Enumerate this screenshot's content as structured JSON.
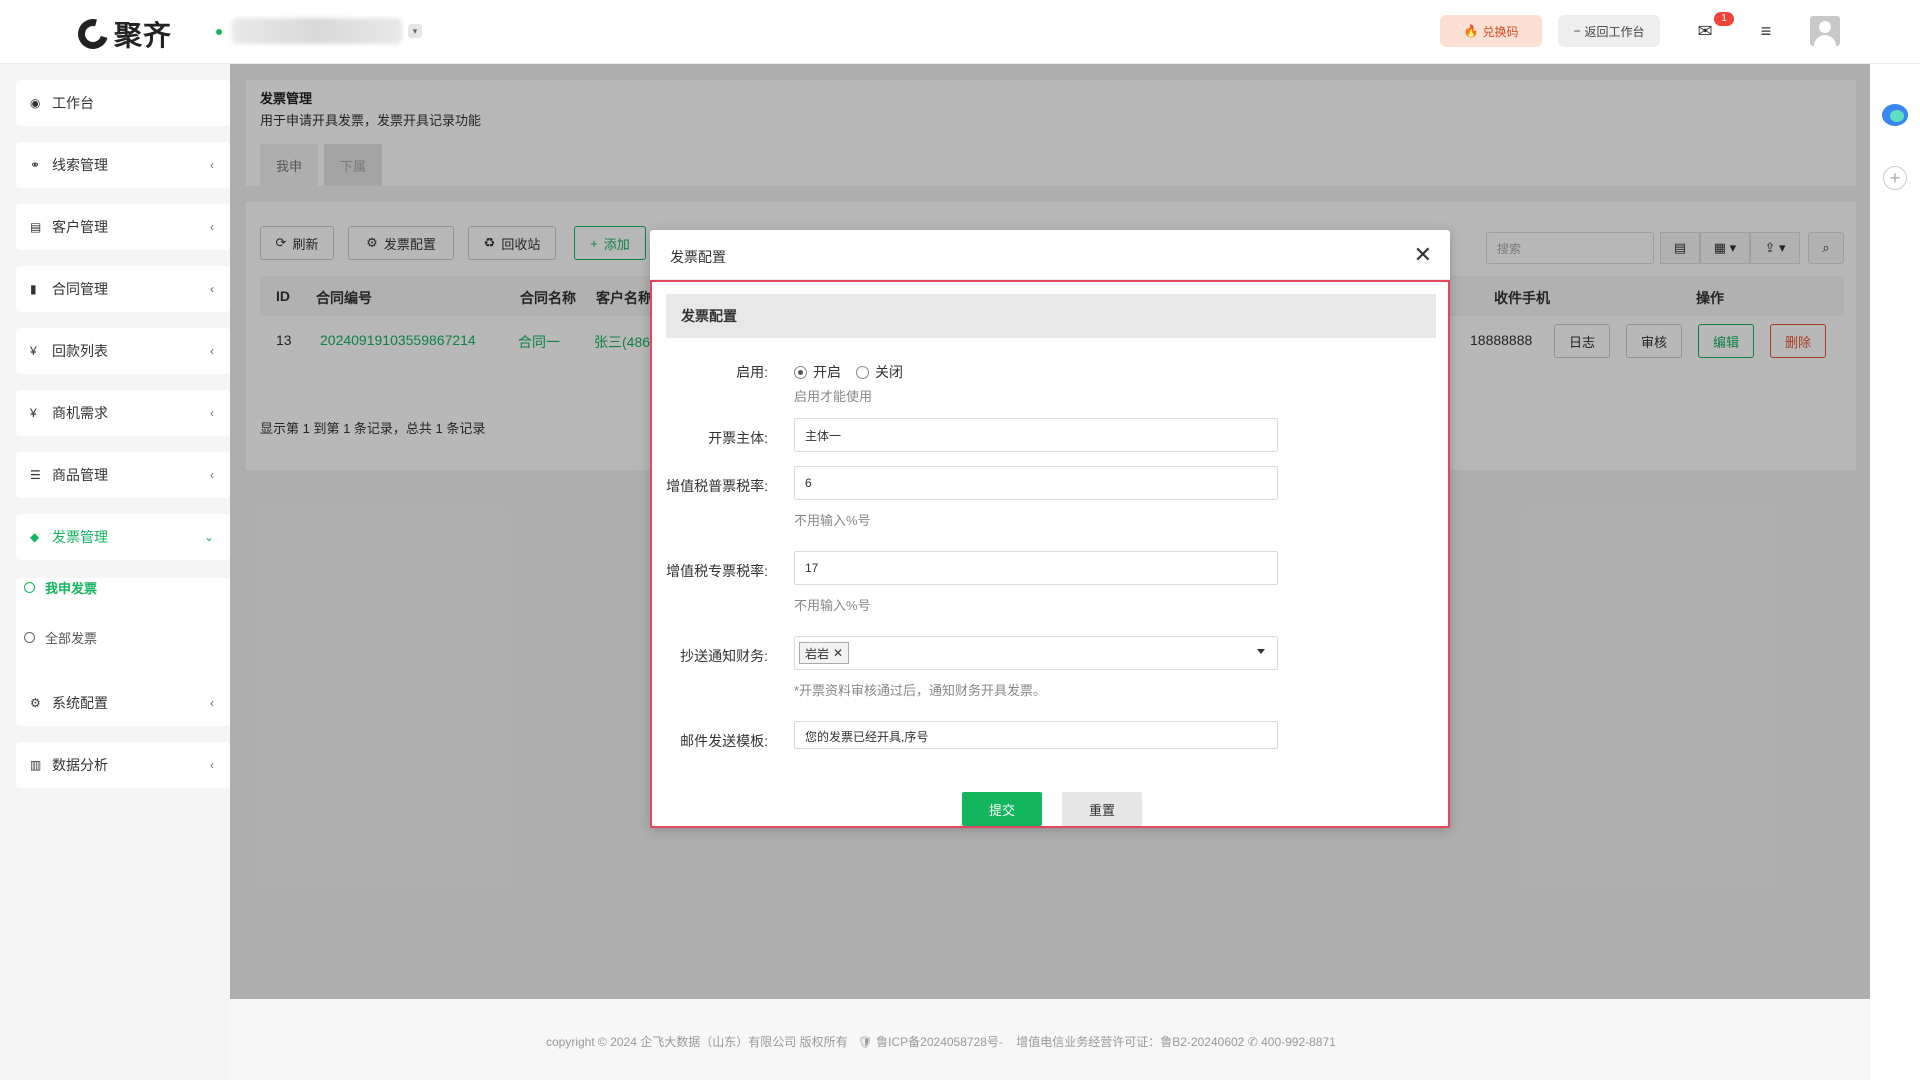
{
  "topbar": {
    "app_name": "聚齐",
    "redeem_label": "兑换码",
    "back_label": "返回工作台",
    "mail_badge": "1"
  },
  "sidebar": {
    "items": [
      {
        "label": "工作台",
        "icon": "dashboard-icon"
      },
      {
        "label": "线索管理",
        "icon": "link-icon"
      },
      {
        "label": "客户管理",
        "icon": "id-card-icon"
      },
      {
        "label": "合同管理",
        "icon": "bookmark-icon"
      },
      {
        "label": "回款列表",
        "icon": "yen-icon"
      },
      {
        "label": "商机需求",
        "icon": "yen-icon"
      },
      {
        "label": "商品管理",
        "icon": "list-icon"
      },
      {
        "label": "发票管理",
        "icon": "tag-icon"
      },
      {
        "label": "系统配置",
        "icon": "gears-icon"
      },
      {
        "label": "数据分析",
        "icon": "bar-chart-icon"
      }
    ],
    "invoice_sub": [
      {
        "label": "我申发票"
      },
      {
        "label": "全部发票"
      }
    ]
  },
  "header": {
    "title": "发票管理",
    "desc": "用于申请开具发票，发票开具记录功能",
    "tabs": [
      "我申",
      "下属"
    ]
  },
  "toolbar": {
    "refresh": "刷新",
    "config": "发票配置",
    "recycle": "回收站",
    "add": "添加",
    "search_placeholder": "搜索"
  },
  "table": {
    "headers": [
      "ID",
      "合同编号",
      "合同名称",
      "客户名称",
      "收件手机",
      "操作"
    ],
    "rows": [
      {
        "id": "13",
        "contract_no": "20240919103559867214",
        "contract_name": "合同一",
        "customer": "张三(486",
        "phone": "18888888"
      }
    ],
    "actions": [
      "日志",
      "审核",
      "编辑",
      "删除"
    ],
    "summary": "显示第 1 到第 1 条记录，总共 1 条记录"
  },
  "modal": {
    "title": "发票配置",
    "section": "发票配置",
    "enable_label": "启用:",
    "enable_on": "开启",
    "enable_off": "关闭",
    "enable_hint": "启用才能使用",
    "entity_label": "开票主体:",
    "entity_value": "主体一",
    "normal_rate_label": "增值税普票税率:",
    "normal_rate_value": "6",
    "normal_rate_hint": "不用输入%号",
    "special_rate_label": "增值税专票税率:",
    "special_rate_value": "17",
    "special_rate_hint": "不用输入%号",
    "cc_label": "抄送通知财务:",
    "cc_tag": "岩岩",
    "cc_hint": "*开票资料审核通过后，通知财务开具发票。",
    "mail_label": "邮件发送模板:",
    "mail_value": "您的发票已经开具,序号",
    "submit": "提交",
    "reset": "重置"
  },
  "footer": {
    "text": "copyright © 2024 企飞大数据（山东）有限公司 版权所有",
    "icp": "鲁ICP备2024058728号-",
    "license": "增值电信业务经营许可证：鲁B2-20240602",
    "phone": "400-992-8871"
  },
  "colors": {
    "brand": "#13b55d",
    "danger": "#e4572e",
    "highlight": "#e4475d"
  }
}
